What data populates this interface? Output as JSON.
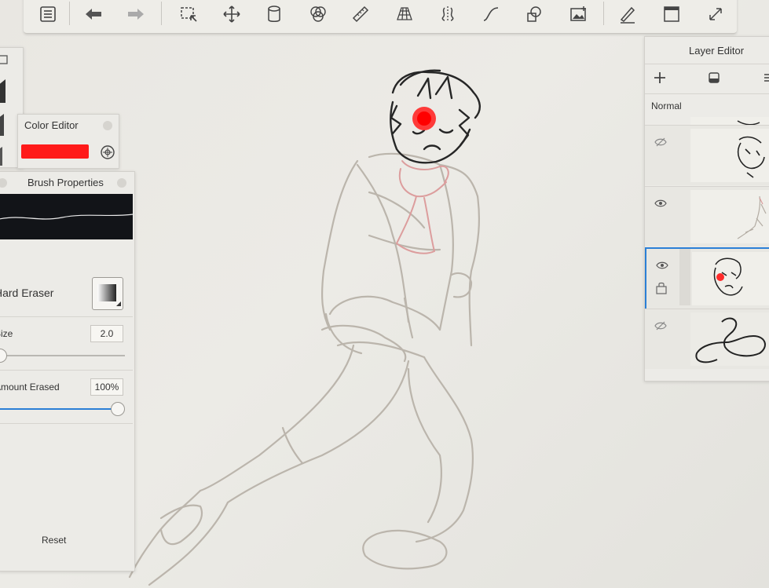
{
  "toolbar": {
    "icons": [
      "list-icon",
      "undo-icon",
      "redo-icon",
      "select-icon",
      "transform-icon",
      "fill-icon",
      "symmetry-icon",
      "ruler-icon",
      "perspective-icon",
      "symmetry-mirror-icon",
      "curve-icon",
      "shapes-icon",
      "image-import-icon",
      "pen-icon",
      "window-icon",
      "fullscreen-icon"
    ]
  },
  "color_editor": {
    "title": "Color Editor",
    "color": "#ff1a1a"
  },
  "brush_properties": {
    "title": "Brush Properties",
    "brush_name": "Hard Eraser",
    "size_label": "Size",
    "size_value": "2.0",
    "size_fraction": 0.0,
    "amount_label": "Amount Erased",
    "amount_value": "100%",
    "amount_fraction": 1.0,
    "reset_label": "Reset"
  },
  "layer_editor": {
    "title": "Layer Editor",
    "blend_mode": "Normal",
    "layers": [
      {
        "visible": false,
        "selected": false
      },
      {
        "visible": true,
        "selected": false
      },
      {
        "visible": true,
        "selected": true
      },
      {
        "visible": false,
        "selected": false
      }
    ]
  },
  "colors": {
    "accent": "#2b7fd6",
    "paint_red": "#ff1a1a",
    "sketch_gray": "#b9b3aa",
    "sketch_pink": "#d99a9a",
    "ink": "#2a2a2a"
  }
}
